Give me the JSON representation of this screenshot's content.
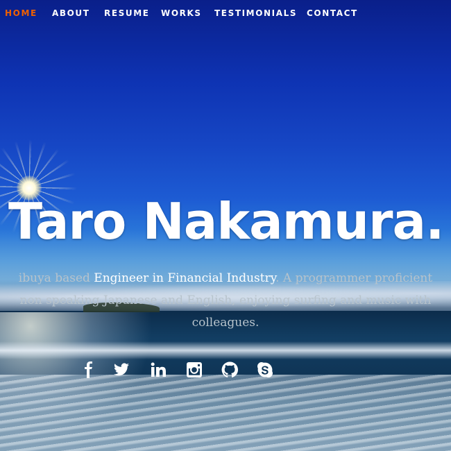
{
  "nav": {
    "items": [
      {
        "label": "HOME",
        "active": true
      },
      {
        "label": "ABOUT",
        "active": false
      },
      {
        "label": "RESUME",
        "active": false
      },
      {
        "label": "WORKS",
        "active": false
      },
      {
        "label": "TESTIMONIALS",
        "active": false
      },
      {
        "label": "CONTACT",
        "active": false
      }
    ],
    "active_color": "#F06000"
  },
  "hero": {
    "title": "Taro Nakamura.",
    "bio": {
      "prefix": "ibuya based ",
      "highlight": "Engineer in Financial Industry",
      "middle": ". A programmer proficient",
      "line2": "non speaking Japanese and English, enjoying surfing and music with",
      "line3": "colleagues."
    }
  },
  "social": [
    {
      "icon": "facebook-icon"
    },
    {
      "icon": "twitter-icon"
    },
    {
      "icon": "linkedin-icon"
    },
    {
      "icon": "instagram-icon"
    },
    {
      "icon": "github-icon"
    },
    {
      "icon": "skype-icon"
    }
  ]
}
